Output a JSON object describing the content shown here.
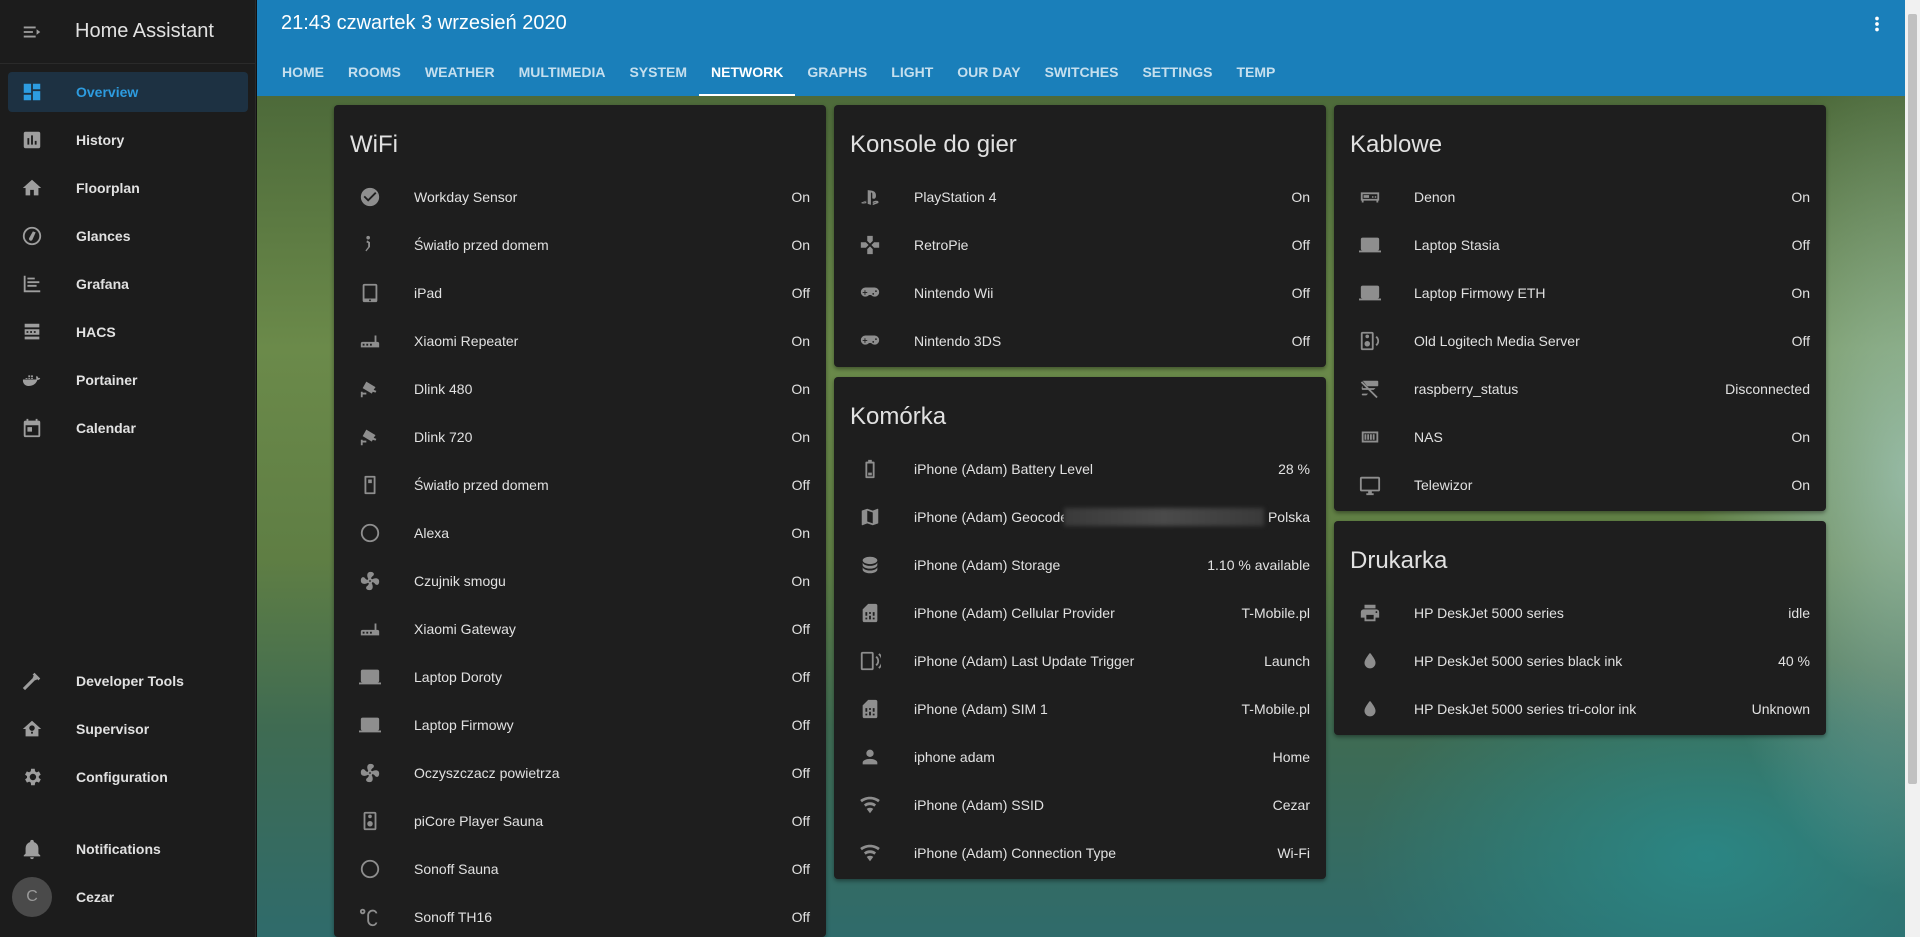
{
  "sidebar": {
    "title": "Home Assistant",
    "items": [
      {
        "label": "Overview",
        "icon": "overview-icon"
      },
      {
        "label": "History",
        "icon": "history-icon"
      },
      {
        "label": "Floorplan",
        "icon": "home-icon"
      },
      {
        "label": "Glances",
        "icon": "gauge-icon"
      },
      {
        "label": "Grafana",
        "icon": "chart-icon"
      },
      {
        "label": "HACS",
        "icon": "hacs-icon"
      },
      {
        "label": "Portainer",
        "icon": "docker-icon"
      },
      {
        "label": "Calendar",
        "icon": "calendar-icon"
      }
    ],
    "bottom": [
      {
        "label": "Developer Tools",
        "icon": "hammer-icon"
      },
      {
        "label": "Supervisor",
        "icon": "supervisor-icon"
      },
      {
        "label": "Configuration",
        "icon": "gear-icon"
      },
      {
        "label": "Notifications",
        "icon": "bell-icon"
      },
      {
        "label": "Cezar",
        "avatar": "C"
      }
    ]
  },
  "header": {
    "title": "21:43 czwartek 3 wrzesień 2020",
    "tabs": [
      "HOME",
      "ROOMS",
      "WEATHER",
      "MULTIMEDIA",
      "SYSTEM",
      "NETWORK",
      "GRAPHS",
      "LIGHT",
      "OUR DAY",
      "SWITCHES",
      "SETTINGS",
      "TEMP"
    ],
    "active_tab": "NETWORK"
  },
  "cards": {
    "wifi": {
      "title": "WiFi",
      "rows": [
        {
          "name": "Workday Sensor",
          "state": "On"
        },
        {
          "name": "Światło przed domem",
          "state": "On"
        },
        {
          "name": "iPad",
          "state": "Off"
        },
        {
          "name": "Xiaomi Repeater",
          "state": "On"
        },
        {
          "name": "Dlink 480",
          "state": "On"
        },
        {
          "name": "Dlink 720",
          "state": "On"
        },
        {
          "name": "Światło przed domem",
          "state": "Off"
        },
        {
          "name": "Alexa",
          "state": "On"
        },
        {
          "name": "Czujnik smogu",
          "state": "On"
        },
        {
          "name": "Xiaomi Gateway",
          "state": "Off"
        },
        {
          "name": "Laptop Doroty",
          "state": "Off"
        },
        {
          "name": "Laptop Firmowy",
          "state": "Off"
        },
        {
          "name": "Oczyszczacz powietrza",
          "state": "Off"
        },
        {
          "name": "piCore Player Sauna",
          "state": "Off"
        },
        {
          "name": "Sonoff Sauna",
          "state": "Off"
        },
        {
          "name": "Sonoff TH16",
          "state": "Off"
        }
      ]
    },
    "konsole": {
      "title": "Konsole do gier",
      "rows": [
        {
          "name": "PlayStation 4",
          "state": "On"
        },
        {
          "name": "RetroPie",
          "state": "Off"
        },
        {
          "name": "Nintendo Wii",
          "state": "Off"
        },
        {
          "name": "Nintendo 3DS",
          "state": "Off"
        }
      ]
    },
    "komorka": {
      "title": "Komórka",
      "rows": [
        {
          "name": "iPhone (Adam) Battery Level",
          "state": "28 %"
        },
        {
          "name": "iPhone (Adam) Geocode…",
          "state": "Polska"
        },
        {
          "name": "iPhone (Adam) Storage",
          "state": "1.10 % available"
        },
        {
          "name": "iPhone (Adam) Cellular Provider",
          "state": "T-Mobile.pl"
        },
        {
          "name": "iPhone (Adam) Last Update Trigger",
          "state": "Launch"
        },
        {
          "name": "iPhone (Adam) SIM 1",
          "state": "T-Mobile.pl"
        },
        {
          "name": "iphone adam",
          "state": "Home"
        },
        {
          "name": "iPhone (Adam) SSID",
          "state": "Cezar"
        },
        {
          "name": "iPhone (Adam) Connection Type",
          "state": "Wi-Fi"
        }
      ]
    },
    "kablowe": {
      "title": "Kablowe",
      "rows": [
        {
          "name": "Denon",
          "state": "On"
        },
        {
          "name": "Laptop Stasia",
          "state": "Off"
        },
        {
          "name": "Laptop Firmowy ETH",
          "state": "On"
        },
        {
          "name": "Old Logitech Media Server",
          "state": "Off"
        },
        {
          "name": "raspberry_status",
          "state": "Disconnected"
        },
        {
          "name": "NAS",
          "state": "On"
        },
        {
          "name": "Telewizor",
          "state": "On"
        }
      ]
    },
    "drukarka": {
      "title": "Drukarka",
      "rows": [
        {
          "name": "HP DeskJet 5000 series",
          "state": "idle"
        },
        {
          "name": "HP DeskJet 5000 series black ink",
          "state": "40 %"
        },
        {
          "name": "HP DeskJet 5000 series tri-color ink",
          "state": "Unknown"
        }
      ]
    }
  }
}
